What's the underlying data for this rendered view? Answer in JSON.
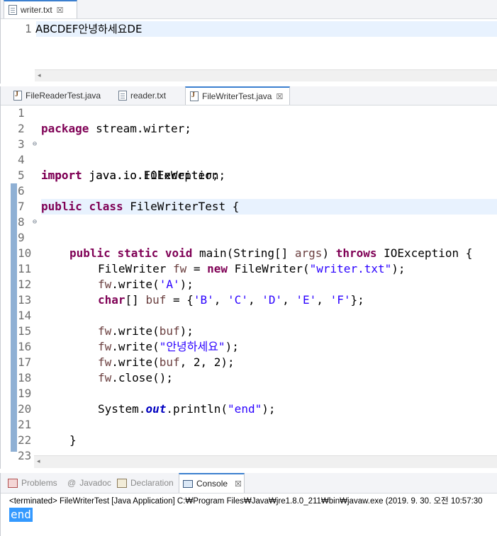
{
  "top_editor": {
    "tab_label": "writer.txt",
    "tab_close": "☒",
    "line_number": "1",
    "line_text": "ABCDEF안녕하세요DE",
    "scroll_left": "◂"
  },
  "java_editor": {
    "tabs": [
      {
        "label": "FileReaderTest.java"
      },
      {
        "label": "reader.txt"
      },
      {
        "label": "FileWriterTest.java",
        "close": "☒"
      }
    ],
    "fold_marker": "⊖",
    "scroll_left": "◂",
    "lines": [
      {
        "n": "1"
      },
      {
        "n": "2"
      },
      {
        "n": "3"
      },
      {
        "n": "4"
      },
      {
        "n": "5"
      },
      {
        "n": "6"
      },
      {
        "n": "7"
      },
      {
        "n": "8"
      },
      {
        "n": "9"
      },
      {
        "n": "10"
      },
      {
        "n": "11"
      },
      {
        "n": "12"
      },
      {
        "n": "13"
      },
      {
        "n": "14"
      },
      {
        "n": "15"
      },
      {
        "n": "16"
      },
      {
        "n": "17"
      },
      {
        "n": "18"
      },
      {
        "n": "19"
      },
      {
        "n": "20"
      },
      {
        "n": "21"
      },
      {
        "n": "22"
      },
      {
        "n": "23"
      }
    ],
    "code": {
      "l1_kw": "package",
      "l1_rest": " stream.wirter;",
      "l3_kw": "import",
      "l3_rest": " java.io.FileWriter;",
      "l4_kw": "import",
      "l4_rest": " java.io.IOException;",
      "l6_kw1": "public",
      "l6_kw2": "class",
      "l6_rest": " FileWriterTest {",
      "l8_kw1": "public",
      "l8_kw2": "static",
      "l8_kw3": "void",
      "l8_a": " main(String[] ",
      "l8_prm": "args",
      "l8_b": ") ",
      "l8_kw4": "throws",
      "l8_c": " IOException {",
      "l10_a": "FileWriter ",
      "l10_var": "fw",
      "l10_b": " = ",
      "l10_kw": "new",
      "l10_c": " FileWriter(",
      "l10_str": "\"writer.txt\"",
      "l10_d": ");",
      "l11_var": "fw",
      "l11_a": ".write(",
      "l11_str": "'A'",
      "l11_b": ");",
      "l12_kw": "char",
      "l12_a": "[] ",
      "l12_var": "buf",
      "l12_b": " = {",
      "l12_s1": "'B'",
      "l12_s2": "'C'",
      "l12_s3": "'D'",
      "l12_s4": "'E'",
      "l12_s5": "'F'",
      "l12_comma": ", ",
      "l12_c": "};",
      "l14_var": "fw",
      "l14_a": ".write(",
      "l14_arg": "buf",
      "l14_b": ");",
      "l15_var": "fw",
      "l15_a": ".write(",
      "l15_str": "\"안녕하세요\"",
      "l15_b": ");",
      "l16_var": "fw",
      "l16_a": ".write(",
      "l16_arg": "buf",
      "l16_b": ", 2, 2);",
      "l17_var": "fw",
      "l17_a": ".close();",
      "l19_a": "System.",
      "l19_out": "out",
      "l19_b": ".println(",
      "l19_str": "\"end\"",
      "l19_c": ");",
      "l21": "}",
      "l23": "}"
    }
  },
  "console": {
    "tabs": [
      {
        "label": "Problems"
      },
      {
        "label": "Javadoc"
      },
      {
        "label": "Declaration"
      },
      {
        "label": "Console",
        "close": "☒"
      }
    ],
    "at_sign": "@",
    "terminated_line": "<terminated> FileWriterTest [Java Application] C:₩Program Files₩Java₩jre1.8.0_211₩bin₩javaw.exe (2019. 9. 30. 오전 10:57:30",
    "output": "end"
  },
  "colors": {
    "keyword": "#7f0055",
    "string": "#2a00ff",
    "field": "#0000c0",
    "local_var": "#6a3e3e",
    "current_line": "#e8f2fe",
    "selection": "#3399ff"
  }
}
